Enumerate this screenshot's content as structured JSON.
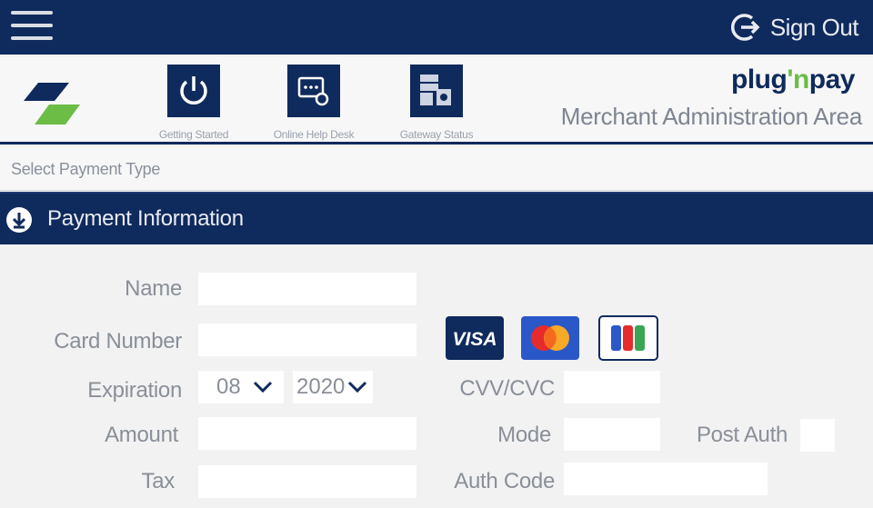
{
  "topbar": {
    "signout_label": "Sign Out"
  },
  "header": {
    "nav": [
      {
        "label": "Getting Started",
        "icon": "power-icon"
      },
      {
        "label": "Online Help Desk",
        "icon": "help-desk-icon"
      },
      {
        "label": "Gateway Status",
        "icon": "gateway-status-icon"
      }
    ],
    "brand_left": "plug",
    "brand_mid": "'n",
    "brand_right": "pay",
    "subtitle": "Merchant Administration Area"
  },
  "payment_type": {
    "label": "Select Payment Type"
  },
  "section": {
    "title": "Payment Information"
  },
  "form": {
    "name_label": "Name",
    "card_number_label": "Card Number",
    "expiration_label": "Expiration",
    "exp_month": "08",
    "exp_year": "2020",
    "cvv_label": "CVV/CVC",
    "amount_label": "Amount",
    "mode_label": "Mode",
    "post_auth_label": "Post Auth",
    "tax_label": "Tax",
    "auth_code_label": "Auth Code",
    "cards": [
      "VISA",
      "mastercard",
      "JCB"
    ]
  },
  "colors": {
    "navy": "#0f2a5c",
    "green": "#6bbd45"
  }
}
